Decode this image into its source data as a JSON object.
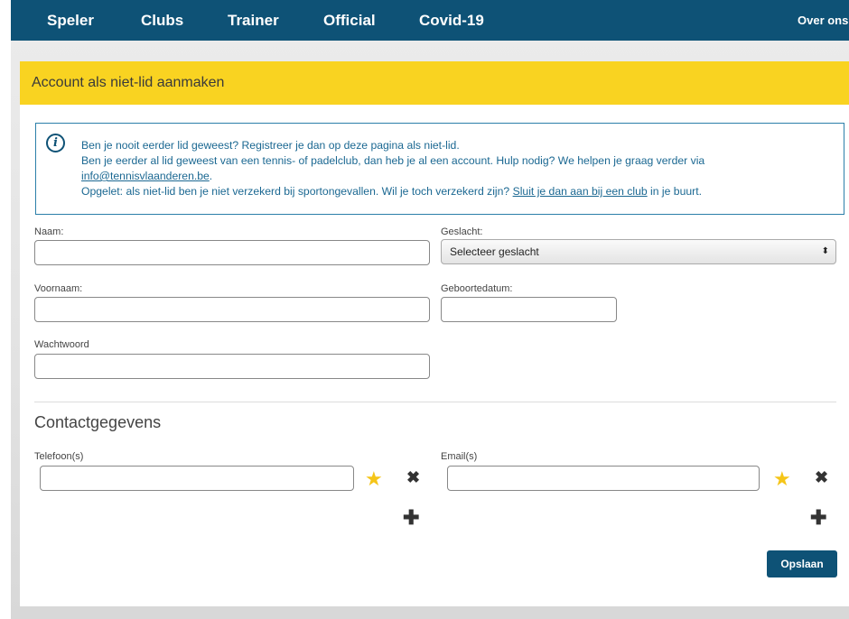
{
  "nav": {
    "items": [
      "Speler",
      "Clubs",
      "Trainer",
      "Official",
      "Covid-19"
    ],
    "right": "Over ons"
  },
  "panel": {
    "title": "Account als niet-lid aanmaken"
  },
  "info": {
    "line1": "Ben je nooit eerder lid geweest? Registreer je dan op deze pagina als niet-lid.",
    "line2": "Ben je eerder al lid geweest van een tennis- of padelclub, dan heb je al een account. Hulp nodig? We helpen je graag verder via",
    "email_link": "info@tennisvlaanderen.be",
    "email_suffix": ".",
    "line4_prefix": "Opgelet: als niet-lid ben je niet verzekerd bij sportongevallen. Wil je toch verzekerd zijn? ",
    "club_link": "Sluit je dan aan bij een club",
    "line4_suffix": " in je buurt."
  },
  "form": {
    "naam_label": "Naam:",
    "geslacht_label": "Geslacht:",
    "geslacht_selected": "Selecteer geslacht",
    "voornaam_label": "Voornaam:",
    "geboortedatum_label": "Geboortedatum:",
    "wachtwoord_label": "Wachtwoord"
  },
  "contact": {
    "title": "Contactgegevens",
    "telefoon_label": "Telefoon(s)",
    "email_label": "Email(s)"
  },
  "actions": {
    "save_label": "Opslaan"
  },
  "colors": {
    "nav_bg": "#0e5276",
    "header_bg": "#f9d321",
    "info_text": "#1b6892",
    "star": "#f5c518"
  },
  "icons": {
    "info": "info-circle-icon",
    "star": "star-icon",
    "remove": "close-icon",
    "add": "plus-icon"
  }
}
